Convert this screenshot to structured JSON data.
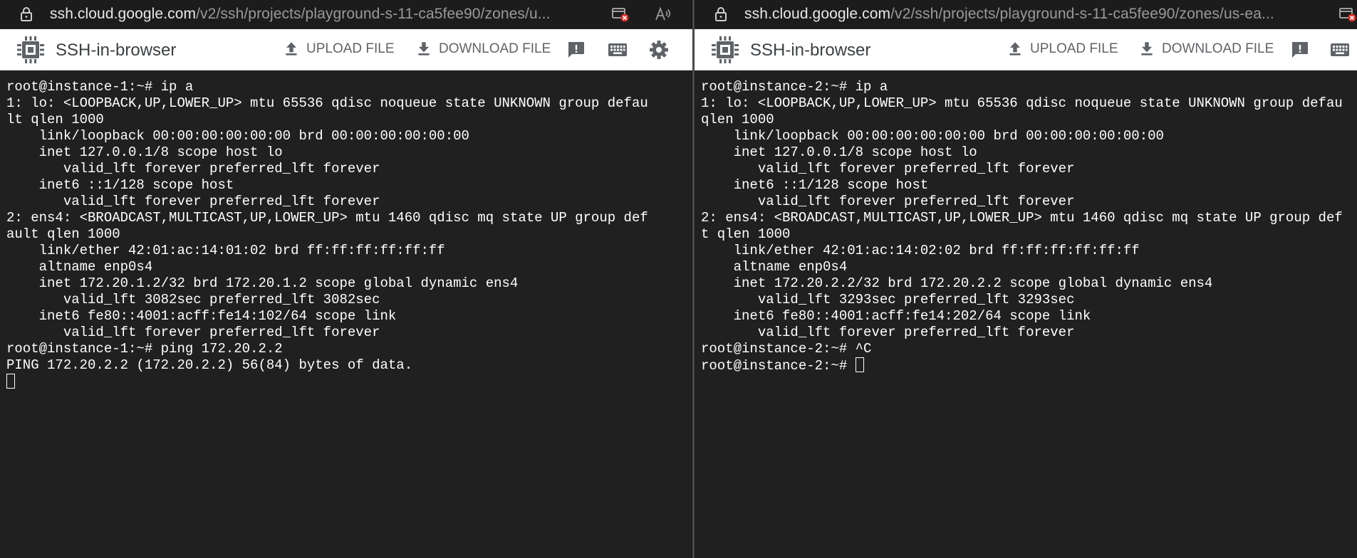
{
  "left": {
    "url_domain": "ssh.cloud.google.com",
    "url_path": "/v2/ssh/projects/playground-s-11-ca5fee90/zones/u...",
    "brand": "SSH-in-browser",
    "upload_label": "UPLOAD FILE",
    "download_label": "DOWNLOAD FILE",
    "lines": [
      "root@instance-1:~# ip a",
      "1: lo: <LOOPBACK,UP,LOWER_UP> mtu 65536 qdisc noqueue state UNKNOWN group defau",
      "lt qlen 1000",
      "    link/loopback 00:00:00:00:00:00 brd 00:00:00:00:00:00",
      "    inet 127.0.0.1/8 scope host lo",
      "       valid_lft forever preferred_lft forever",
      "    inet6 ::1/128 scope host",
      "       valid_lft forever preferred_lft forever",
      "2: ens4: <BROADCAST,MULTICAST,UP,LOWER_UP> mtu 1460 qdisc mq state UP group def",
      "ault qlen 1000",
      "    link/ether 42:01:ac:14:01:02 brd ff:ff:ff:ff:ff:ff",
      "    altname enp0s4",
      "    inet 172.20.1.2/32 brd 172.20.1.2 scope global dynamic ens4",
      "       valid_lft 3082sec preferred_lft 3082sec",
      "    inet6 fe80::4001:acff:fe14:102/64 scope link",
      "       valid_lft forever preferred_lft forever",
      "root@instance-1:~# ping 172.20.2.2",
      "PING 172.20.2.2 (172.20.2.2) 56(84) bytes of data.",
      ""
    ]
  },
  "right": {
    "url_domain": "ssh.cloud.google.com",
    "url_path": "/v2/ssh/projects/playground-s-11-ca5fee90/zones/us-ea...",
    "brand": "SSH-in-browser",
    "upload_label": "UPLOAD FILE",
    "download_label": "DOWNLOAD FILE",
    "lines": [
      "root@instance-2:~# ip a",
      "1: lo: <LOOPBACK,UP,LOWER_UP> mtu 65536 qdisc noqueue state UNKNOWN group defau",
      "qlen 1000",
      "    link/loopback 00:00:00:00:00:00 brd 00:00:00:00:00:00",
      "    inet 127.0.0.1/8 scope host lo",
      "       valid_lft forever preferred_lft forever",
      "    inet6 ::1/128 scope host",
      "       valid_lft forever preferred_lft forever",
      "2: ens4: <BROADCAST,MULTICAST,UP,LOWER_UP> mtu 1460 qdisc mq state UP group def",
      "t qlen 1000",
      "    link/ether 42:01:ac:14:02:02 brd ff:ff:ff:ff:ff:ff",
      "    altname enp0s4",
      "    inet 172.20.2.2/32 brd 172.20.2.2 scope global dynamic ens4",
      "       valid_lft 3293sec preferred_lft 3293sec",
      "    inet6 fe80::4001:acff:fe14:202/64 scope link",
      "       valid_lft forever preferred_lft forever",
      "root@instance-2:~# ^C",
      "root@instance-2:~# "
    ]
  },
  "icons": {
    "lock": "lock-icon",
    "site_info": "site-info-blocked-icon",
    "read_aloud": "read-aloud-icon",
    "brand": "cpu-chip-icon",
    "upload": "upload-icon",
    "download": "download-icon",
    "feedback": "feedback-icon",
    "keyboard": "keyboard-icon",
    "settings": "gear-icon"
  },
  "colors": {
    "terminal_bg": "#202020",
    "terminal_text": "#ffffff",
    "toolbar_bg": "#ffffff",
    "toolbar_text": "#5f6368",
    "urlbar_bg": "#1c1c1c",
    "blocked_badge": "#d93025"
  }
}
